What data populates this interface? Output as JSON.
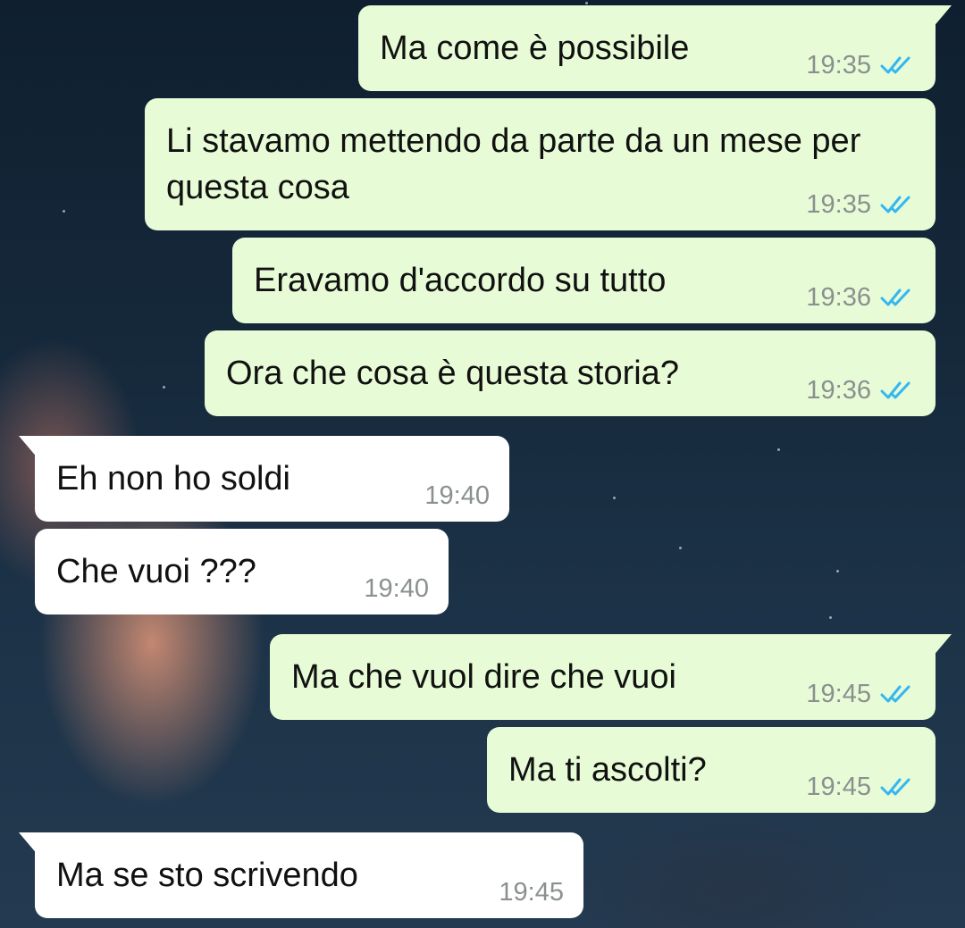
{
  "messages": [
    {
      "text": "Ma come è possibile",
      "time": "19:35",
      "direction": "outgoing",
      "status": "read"
    },
    {
      "text": "Li stavamo mettendo da parte da un mese per questa cosa",
      "time": "19:35",
      "direction": "outgoing",
      "status": "read"
    },
    {
      "text": "Eravamo d'accordo su tutto",
      "time": "19:36",
      "direction": "outgoing",
      "status": "read"
    },
    {
      "text": "Ora che cosa è questa storia?",
      "time": "19:36",
      "direction": "outgoing",
      "status": "read"
    },
    {
      "text": "Eh non ho soldi",
      "time": "19:40",
      "direction": "incoming"
    },
    {
      "text": "Che vuoi ???",
      "time": "19:40",
      "direction": "incoming"
    },
    {
      "text": "Ma che vuol dire che vuoi",
      "time": "19:45",
      "direction": "outgoing",
      "status": "read"
    },
    {
      "text": "Ma ti ascolti?",
      "time": "19:45",
      "direction": "outgoing",
      "status": "read"
    },
    {
      "text": "Ma se sto scrivendo",
      "time": "19:45",
      "direction": "incoming"
    }
  ],
  "colors": {
    "outgoing_bubble": "#e7fcd6",
    "incoming_bubble": "#ffffff",
    "read_ticks": "#34b7f1",
    "timestamp": "#8a9090"
  },
  "icons": {
    "read_status": "double-check-icon"
  }
}
